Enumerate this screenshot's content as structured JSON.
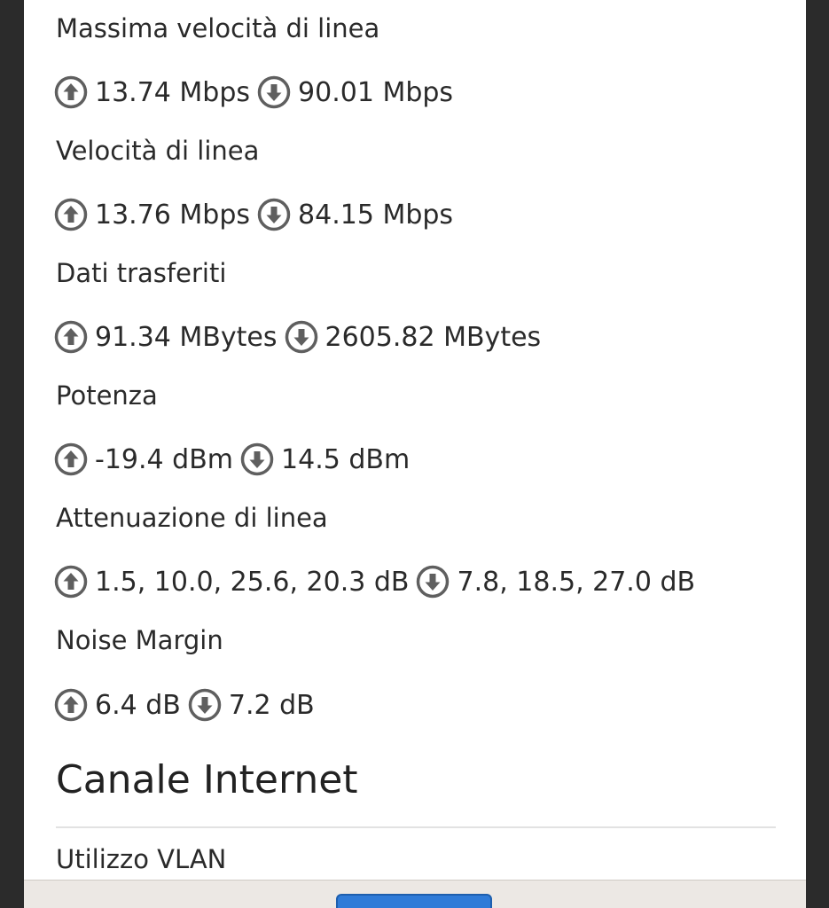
{
  "dsl": {
    "max_line_speed": {
      "label": "Massima velocità di linea",
      "up": "13.74 Mbps",
      "down": "90.01 Mbps"
    },
    "line_speed": {
      "label": "Velocità di linea",
      "up": "13.76 Mbps",
      "down": "84.15 Mbps"
    },
    "data_transferred": {
      "label": "Dati trasferiti",
      "up": "91.34 MBytes",
      "down": "2605.82 MBytes"
    },
    "power": {
      "label": "Potenza",
      "up": "-19.4 dBm",
      "down": "14.5 dBm"
    },
    "line_attenuation": {
      "label": "Attenuazione di linea",
      "up": "1.5, 10.0, 25.6, 20.3 dB",
      "down": "7.8, 18.5, 27.0 dB"
    },
    "noise_margin": {
      "label": "Noise Margin",
      "up": "6.4 dB",
      "down": "7.2 dB"
    }
  },
  "internet_channel": {
    "title": "Canale Internet",
    "vlan_label": "Utilizzo VLAN"
  },
  "icons": {
    "up": "arrow-up-circle-icon",
    "down": "arrow-down-circle-icon"
  },
  "colors": {
    "icon": "#5f5f5f",
    "text": "#2a2a2a",
    "button": "#2f7bd8"
  }
}
